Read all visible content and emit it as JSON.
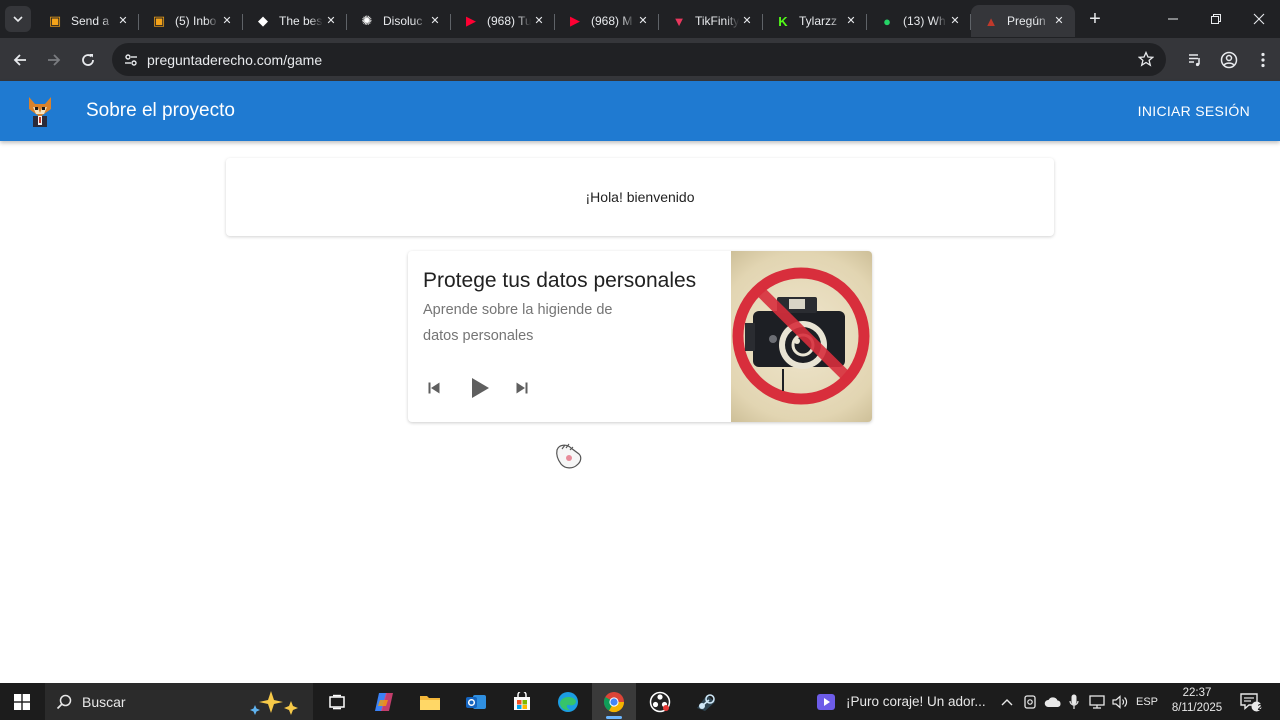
{
  "browser": {
    "tabs": [
      {
        "title": "Send a",
        "icon": "pastebin-like-orange-icon",
        "color": "#f4a31a",
        "active": false
      },
      {
        "title": "(5) Inbo",
        "icon": "mail-orange-icon",
        "color": "#f4a31a",
        "active": false
      },
      {
        "title": "The bes",
        "icon": "diamond-icon",
        "color": "#ffffff",
        "active": false
      },
      {
        "title": "Disoluc",
        "icon": "openai-icon",
        "color": "#ffffff",
        "active": false
      },
      {
        "title": "(968) Tu",
        "icon": "youtube-icon",
        "color": "#ff0033",
        "active": false
      },
      {
        "title": "(968) M",
        "icon": "youtube-icon",
        "color": "#ff0033",
        "active": false
      },
      {
        "title": "TikFinity",
        "icon": "tikfinity-icon",
        "color": "#e8375d",
        "active": false
      },
      {
        "title": "Tylarzz",
        "icon": "kick-icon",
        "color": "#53fc18",
        "active": false
      },
      {
        "title": "(13) Wh",
        "icon": "whatsapp-icon",
        "color": "#25d366",
        "active": false
      },
      {
        "title": "Pregún",
        "icon": "fox-icon",
        "color": "#c0392b",
        "active": true
      }
    ],
    "url": "preguntaderecho.com/game"
  },
  "appbar": {
    "title": "Sobre el proyecto",
    "login_label": "INICIAR SESIÓN",
    "color": "#1f7ad1"
  },
  "welcome": {
    "text": "¡Hola! bienvenido"
  },
  "media_card": {
    "title": "Protege tus datos personales",
    "subtitle": "Aprende sobre la higiende de datos personales",
    "image_icon": "no-camera-icon",
    "controls": [
      "skip-previous-icon",
      "play-icon",
      "skip-next-icon"
    ]
  },
  "taskbar": {
    "search_placeholder": "Buscar",
    "news_text": "¡Puro coraje! Un ador...",
    "language": "ESP",
    "time": "22:37",
    "date": "8/11/2025",
    "notification_count": "2"
  }
}
